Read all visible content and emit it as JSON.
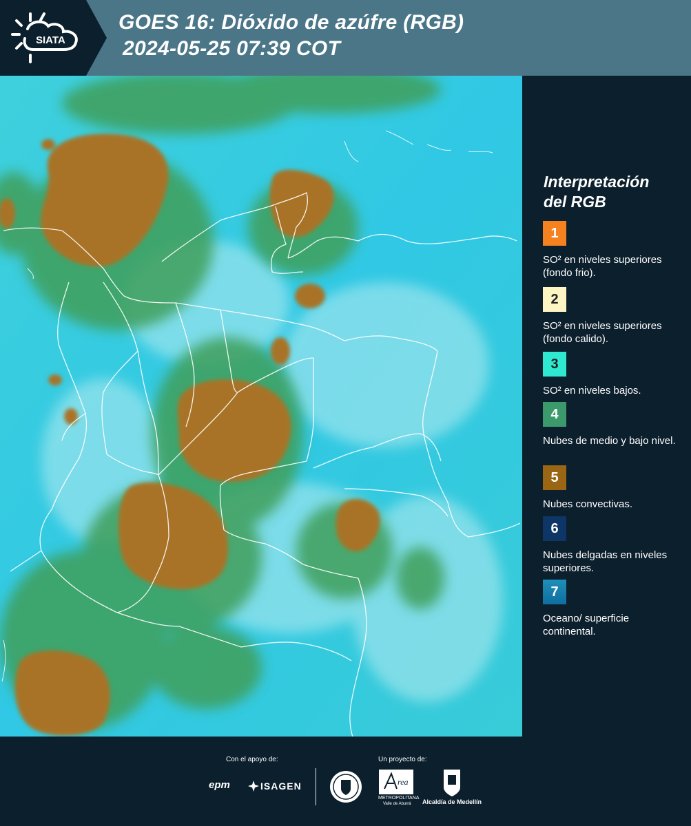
{
  "header": {
    "logo_text": "SIATA",
    "title_line1": "GOES 16: Dióxido de azúfre (RGB)",
    "title_line2": "2024-05-25 07:39 COT"
  },
  "legend": {
    "title_line1": "Interpretación",
    "title_line2": "del RGB",
    "items": [
      {
        "number": "1",
        "color": "#f5821f",
        "text": "SO² en niveles superiores (fondo frio)."
      },
      {
        "number": "2",
        "color": "#fdf6c3",
        "text": "SO² en niveles superiores (fondo calido)."
      },
      {
        "number": "3",
        "color": "#2ee8cf",
        "text": "SO² en niveles bajos."
      },
      {
        "number": "4",
        "color": "#3b9a6c",
        "text": "Nubes de medio y bajo nivel."
      },
      {
        "number": "5",
        "color": "#9a6614",
        "text": "Nubes convectivas."
      },
      {
        "number": "6",
        "color": "#0d3566",
        "text": "Nubes delgadas en niveles superiores."
      },
      {
        "number": "7",
        "color": "#1e8fb8",
        "text": "Oceano/ superficie continental."
      }
    ]
  },
  "map": {
    "ocean_color": "#2fc9e0",
    "convective_color": "#a87328",
    "midlevel_color": "#3c9a58",
    "border_color": "#ffffff"
  },
  "footer": {
    "support_label": "Con el apoyo de:",
    "project_label": "Un proyecto de:",
    "sponsor_epm": "epm",
    "sponsor_isagen": "ISAGEN",
    "area_label": "METROPOLITANA",
    "area_sub": "Valle de Aburrá",
    "alcaldia_label": "Alcaldía de Medellín"
  }
}
